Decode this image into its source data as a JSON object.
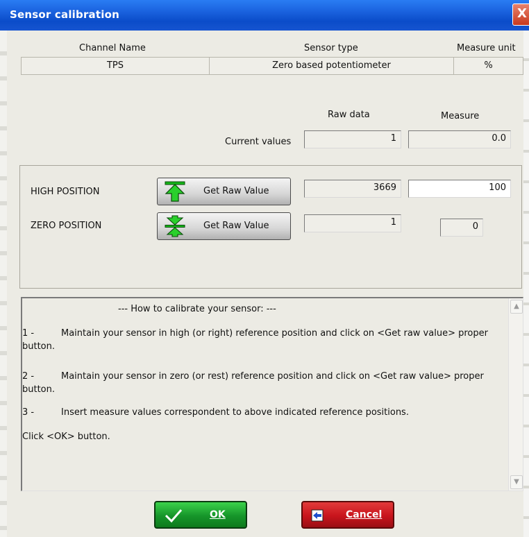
{
  "window": {
    "title": "Sensor calibration",
    "close": "X"
  },
  "channel": {
    "headers": {
      "channel_name": "Channel Name",
      "sensor_type": "Sensor type",
      "measure_unit": "Measure unit"
    },
    "values": {
      "channel_name": "TPS",
      "sensor_type": "Zero based potentiometer",
      "measure_unit": "%"
    }
  },
  "current": {
    "raw_header": "Raw data",
    "measure_header": "Measure",
    "label": "Current values",
    "raw": "1",
    "measure": "0.0"
  },
  "high": {
    "label": "HIGH POSITION",
    "button": "Get Raw Value",
    "raw": "3669",
    "measure": "100",
    "icon": "arrow-up-to-line-icon"
  },
  "zero": {
    "label": "ZERO POSITION",
    "button": "Get Raw Value",
    "raw": "1",
    "measure": "0",
    "icon": "arrows-converge-icon"
  },
  "help": {
    "title": "--- How to calibrate your sensor: ---",
    "steps": [
      {
        "num": "1 -",
        "text": "Maintain your sensor in high (or right) reference position and click on <Get raw value> proper",
        "cont": "button."
      },
      {
        "num": "2 -",
        "text": "Maintain your sensor in zero (or rest) reference position and click on <Get raw value> proper",
        "cont": "button."
      },
      {
        "num": "3 -",
        "text": "Insert measure values correspondent to above indicated reference positions."
      }
    ],
    "footer": "Click <OK> button."
  },
  "buttons": {
    "ok": "OK",
    "cancel": "Cancel"
  },
  "colors": {
    "titlebar": "#0b4cc9",
    "ok": "#1f9e2a",
    "cancel": "#c8141c"
  }
}
